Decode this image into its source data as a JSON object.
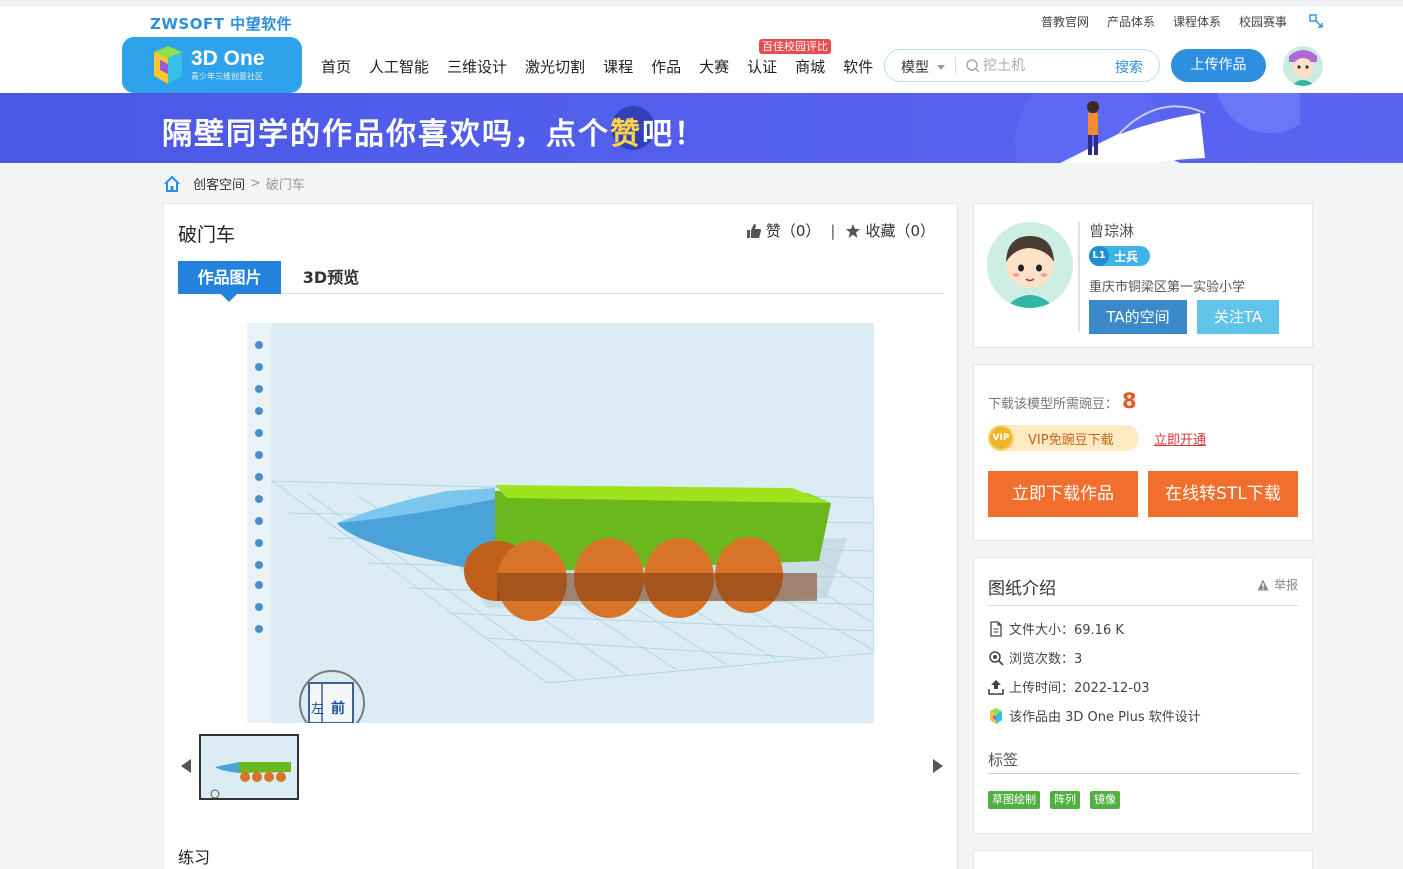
{
  "top_bar": {
    "logo": "ZWSOFT 中望软件",
    "links": [
      "普教官网",
      "产品体系",
      "课程体系",
      "校园赛事"
    ]
  },
  "nav": {
    "logo_title": "3D One",
    "logo_subtitle": "青少年三维创意社区",
    "items": [
      "首页",
      "人工智能",
      "三维设计",
      "激光切割",
      "课程",
      "作品",
      "大赛",
      "认证",
      "商城",
      "软件"
    ],
    "badge": "百佳校园评比",
    "search": {
      "type": "模型",
      "placeholder": "挖土机",
      "button": "搜索"
    },
    "upload_button": "上传作品"
  },
  "banner": {
    "text_before": "隔壁同学的作品你喜欢吗，点个",
    "highlight": "赞",
    "text_after": "吧！"
  },
  "breadcrumb": {
    "parent": "创客空间",
    "separator": ">",
    "current": "破门车"
  },
  "work": {
    "title": "破门车",
    "like_label": "赞（0）",
    "collect_label": "收藏（0）",
    "divider": "|",
    "tabs": [
      "作品图片",
      "3D预览"
    ],
    "description": "练习"
  },
  "user": {
    "name": "曾琮淋",
    "level": "L1",
    "rank": "士兵",
    "school": "重庆市铜梁区第一实验小学",
    "space_button": "TA的空间",
    "follow_button": "关注TA"
  },
  "download": {
    "need_label": "下载该模型所需豌豆：",
    "need_value": "8",
    "vip_icon": "VIP",
    "vip_label": "VIP免豌豆下载",
    "vip_open": "立即开通",
    "download_button": "立即下载作品",
    "stl_button": "在线转STL下载"
  },
  "info": {
    "title": "图纸介绍",
    "report": "举报",
    "file_size": "文件大小：69.16 K",
    "views": "浏览次数：3",
    "upload_time": "上传时间：2022-12-03",
    "software": "该作品由 3D One Plus 软件设计",
    "tags_title": "标签",
    "tags": [
      "草图绘制",
      "阵列",
      "镜像"
    ]
  },
  "viewcube": {
    "left": "左",
    "front": "前"
  },
  "colors": {
    "brand_blue": "#2e8fe0",
    "banner": "#4b58e6",
    "orange": "#f16e2c",
    "tag_green": "#52b043"
  }
}
